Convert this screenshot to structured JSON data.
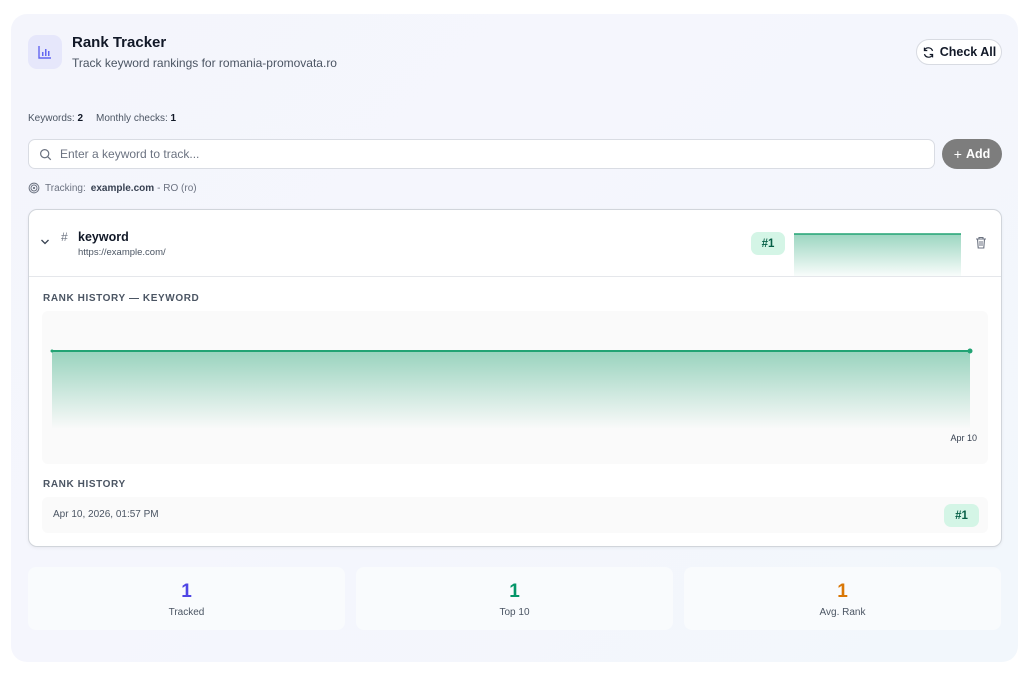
{
  "header": {
    "title": "Rank Tracker",
    "subtitle": "Track keyword rankings for romania-promovata.ro",
    "check_all_label": "Check All",
    "app_icon": "bar-chart-icon"
  },
  "stats": {
    "keywords_label": "Keywords:",
    "keywords_value": "2",
    "monthly_label": "Monthly checks:",
    "monthly_value": "1"
  },
  "search": {
    "placeholder": "Enter a keyword to track...",
    "value": "",
    "add_label": "Add"
  },
  "tracking": {
    "prefix": "Tracking:",
    "domain": "example.com",
    "locale": "- RO (ro)"
  },
  "keyword_row": {
    "hash": "#",
    "keyword": "keyword",
    "url": "https://example.com/",
    "rank": "#1",
    "expanded": true
  },
  "rank_history_chart_title": "RANK HISTORY — KEYWORD",
  "chart_data": {
    "type": "area",
    "title": "RANK HISTORY — KEYWORD",
    "x": [
      "Apr 10"
    ],
    "tick_labels": [
      "Apr 10"
    ],
    "series": [
      {
        "values": [
          1
        ]
      }
    ],
    "color": "#22a374"
  },
  "rank_history_list": {
    "title": "RANK HISTORY",
    "entries": [
      {
        "date": "Apr 10, 2026, 01:57 PM",
        "rank": "#1"
      }
    ]
  },
  "summary": [
    {
      "value": "1",
      "label": "Tracked",
      "color": "#4f46e5"
    },
    {
      "value": "1",
      "label": "Top 10",
      "color": "#059669"
    },
    {
      "value": "1",
      "label": "Avg. Rank",
      "color": "#d97706"
    }
  ],
  "colors": {
    "accent": "#4f46e5",
    "green": "#22a374",
    "badge_bg": "#d4f5e6",
    "badge_fg": "#065f46"
  }
}
